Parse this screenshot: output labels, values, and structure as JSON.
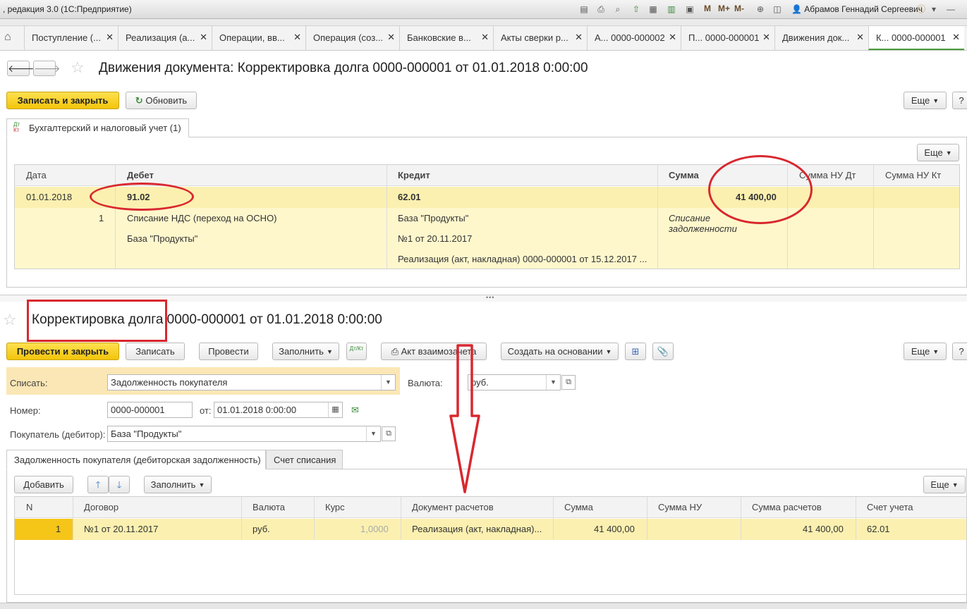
{
  "window": {
    "title": ", редакция 3.0  (1С:Предприятие)",
    "user": "Абрамов Геннадий Сергеевич",
    "m_buttons": [
      "M",
      "M+",
      "M-"
    ]
  },
  "tabs": [
    {
      "label": "Поступление (...",
      "active": false
    },
    {
      "label": "Реализация (а...",
      "active": false
    },
    {
      "label": "Операции, вв...",
      "active": false
    },
    {
      "label": "Операция (соз...",
      "active": false
    },
    {
      "label": "Банковские в...",
      "active": false
    },
    {
      "label": "Акты сверки р...",
      "active": false
    },
    {
      "label": "А... 0000-000002",
      "active": false
    },
    {
      "label": "П... 0000-000001",
      "active": false
    },
    {
      "label": "Движения док...",
      "active": false
    },
    {
      "label": "К... 0000-000001",
      "active": true
    }
  ],
  "top_form": {
    "title": "Движения документа: Корректировка долга 0000-000001 от 01.01.2018 0:00:00",
    "save_close": "Записать и закрыть",
    "refresh": "Обновить",
    "more": "Еще",
    "help": "?",
    "tab_label": "Бухгалтерский и налоговый учет (1)",
    "tab_icon": "Дт/Кт",
    "inner_more": "Еще",
    "columns": [
      "Дата",
      "Дебет",
      "Кредит",
      "Сумма",
      "Сумма НУ Дт",
      "Сумма НУ Кт"
    ],
    "row": {
      "date": "01.01.2018",
      "line_no": "1",
      "debit_account": "91.02",
      "debit_sub1": "Списание НДС (переход на ОСНО)",
      "debit_sub2": "База \"Продукты\"",
      "credit_account": "62.01",
      "credit_sub1": "База \"Продукты\"",
      "credit_sub2": "№1 от 20.11.2017",
      "credit_sub3": "Реализация (акт, накладная) 0000-000001 от 15.12.2017 ...",
      "amount": "41 400,00",
      "content_line1": "Списание",
      "content_line2": "задолженности"
    }
  },
  "bottom_form": {
    "title_part1": "Корректировка долга",
    "title_part2": " 0000-000001 от 01.01.2018 0:00:00",
    "buttons": {
      "post_close": "Провести и закрыть",
      "save": "Записать",
      "post": "Провести",
      "fill": "Заполнить",
      "dtkt": "Дт/Кт",
      "act": "Акт взаимозачета",
      "create_based": "Создать на основании",
      "more": "Еще",
      "help": "?"
    },
    "fields": {
      "write_off_label": "Списать:",
      "write_off_value": "Задолженность покупателя",
      "currency_label": "Валюта:",
      "currency_value": "руб.",
      "number_label": "Номер:",
      "number_value": "0000-000001",
      "date_label": "от:",
      "date_value": "01.01.2018  0:00:00",
      "buyer_label": "Покупатель (дебитор):",
      "buyer_value": "База \"Продукты\""
    },
    "tabs": [
      "Задолженность покупателя (дебиторская задолженность)",
      "Счет списания"
    ],
    "table_toolbar": {
      "add": "Добавить",
      "fill": "Заполнить",
      "more": "Еще"
    },
    "columns": [
      "N",
      "Договор",
      "Валюта",
      "Курс",
      "Документ расчетов",
      "Сумма",
      "Сумма НУ",
      "Сумма расчетов",
      "Счет учета"
    ],
    "rows": [
      {
        "n": "1",
        "contract": "№1 от 20.11.2017",
        "currency": "руб.",
        "rate": "1,0000",
        "doc": "Реализация (акт, накладная)...",
        "amount": "41 400,00",
        "amount_nu": "",
        "amount_settle": "41 400,00",
        "account": "62.01"
      }
    ]
  }
}
